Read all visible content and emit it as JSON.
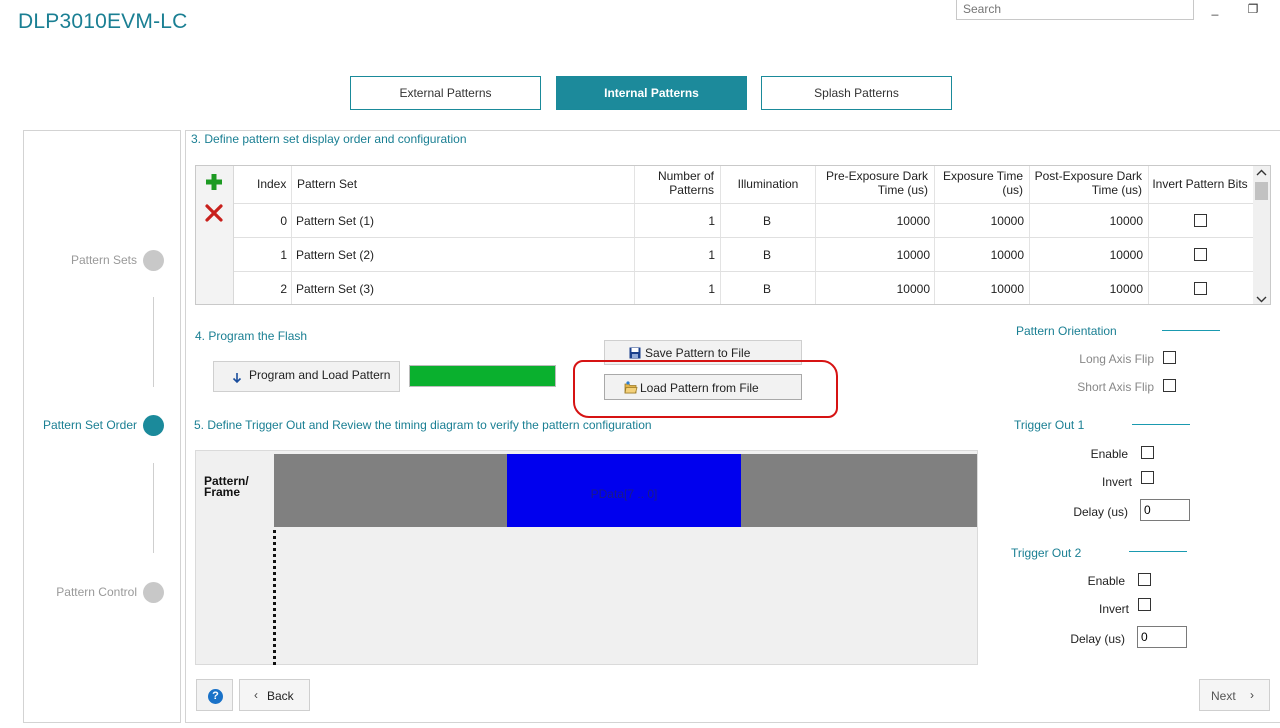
{
  "app": {
    "title": "DLP3010EVM-LC"
  },
  "search": {
    "placeholder": "Search"
  },
  "window_controls": {
    "minimize": "_",
    "restore": "❐"
  },
  "tabs": [
    {
      "label": "External Patterns",
      "active": false
    },
    {
      "label": "Internal Patterns",
      "active": true
    },
    {
      "label": "Splash Patterns",
      "active": false
    }
  ],
  "steps": [
    {
      "label": "Pattern Sets",
      "active": false
    },
    {
      "label": "Pattern Set Order",
      "active": true
    },
    {
      "label": "Pattern Control",
      "active": false
    }
  ],
  "section3": {
    "title": "3. Define pattern set display order and configuration",
    "headers": {
      "index": "Index",
      "pattern_set": "Pattern Set",
      "num_patterns_1": "Number of",
      "num_patterns_2": "Patterns",
      "illumination": "Illumination",
      "pre_exposure_1": "Pre-Exposure Dark",
      "pre_exposure_2": "Time (us)",
      "exposure_1": "Exposure Time",
      "exposure_2": "(us)",
      "post_exposure_1": "Post-Exposure Dark",
      "post_exposure_2": "Time (us)",
      "invert_bits": "Invert Pattern Bits"
    },
    "rows": [
      {
        "index": "0",
        "pattern_set": "Pattern Set (1)",
        "num_patterns": "1",
        "illumination": "B",
        "pre": "10000",
        "exposure": "10000",
        "post": "10000"
      },
      {
        "index": "1",
        "pattern_set": "Pattern Set (2)",
        "num_patterns": "1",
        "illumination": "B",
        "pre": "10000",
        "exposure": "10000",
        "post": "10000"
      },
      {
        "index": "2",
        "pattern_set": "Pattern Set (3)",
        "num_patterns": "1",
        "illumination": "B",
        "pre": "10000",
        "exposure": "10000",
        "post": "10000"
      }
    ]
  },
  "section4": {
    "title": "4. Program the Flash",
    "program_button": "Program and Load Pattern",
    "save_button": "Save Pattern to File",
    "load_button": "Load Pattern from File",
    "progress_fraction": 1.0
  },
  "section5": {
    "title": "5. Define Trigger Out and Review the timing diagram to verify the pattern configuration",
    "pattern_frame_label_1": "Pattern/",
    "pattern_frame_label_2": "Frame",
    "pdata_label": "PData[7 .. 0]"
  },
  "orientation": {
    "title": "Pattern Orientation",
    "long_axis": "Long Axis Flip",
    "short_axis": "Short Axis Flip"
  },
  "trigger1": {
    "title": "Trigger Out 1",
    "enable": "Enable",
    "invert": "Invert",
    "delay": "Delay (us)",
    "delay_value": "0"
  },
  "trigger2": {
    "title": "Trigger Out 2",
    "enable": "Enable",
    "invert": "Invert",
    "delay": "Delay (us)",
    "delay_value": "0"
  },
  "footer": {
    "help": "?",
    "back": "Back",
    "next": "Next"
  },
  "colors": {
    "accent": "#1c8a9b",
    "progress": "#0ab02e",
    "pdata": "#0000ee",
    "highlight": "#d61313"
  }
}
